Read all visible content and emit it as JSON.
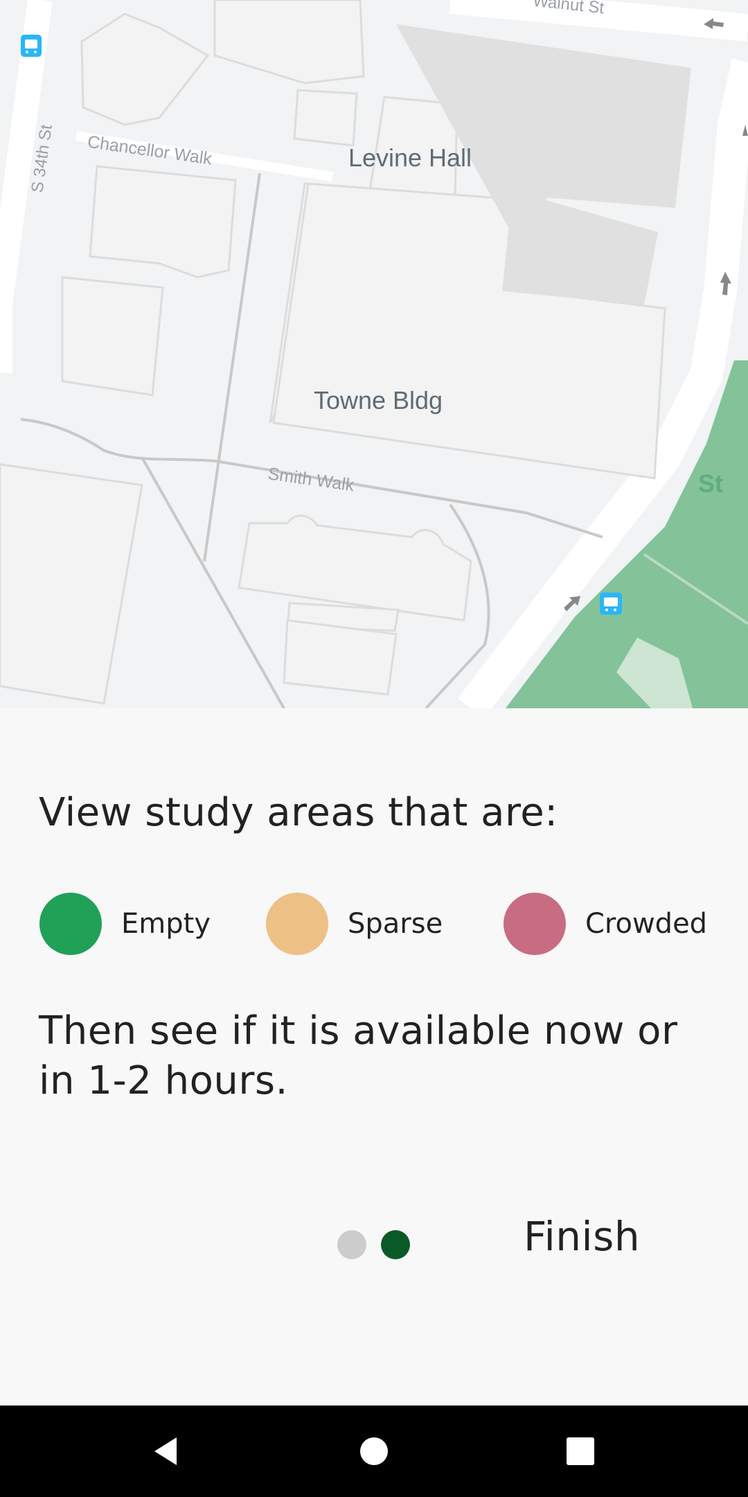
{
  "map": {
    "labels": {
      "levine_hall": "Levine Hall",
      "towne_bldg": "Towne Bldg",
      "chancellor_walk": "Chancellor Walk",
      "smith_walk": "Smith Walk",
      "s34th_st": "S 34th St",
      "walnut_st": "Walnut St",
      "park_label": "St"
    },
    "colors": {
      "background": "#f1f3f4",
      "building": "#f3f3f3",
      "building_edge": "#dcdcdc",
      "dark_building": "#e0e0e0",
      "road": "#ffffff",
      "path": "#c8c8c8",
      "park": "#84c29a",
      "park_light": "#cde5d3",
      "transit_icon": "#29b6f6"
    },
    "icons": [
      "bus-stop-icon",
      "direction-arrow-icon"
    ]
  },
  "panel": {
    "heading": "View study areas that are:",
    "legend": [
      {
        "label": "Empty",
        "color": "#21a058"
      },
      {
        "label": "Sparse",
        "color": "#edc086"
      },
      {
        "label": "Crowded",
        "color": "#c86c82"
      }
    ],
    "description": "Then see if it is available now or in 1-2 hours.",
    "pager": {
      "total": 2,
      "current": 2,
      "inactive_color": "#cccccc",
      "active_color": "#0b5a26"
    },
    "finish_label": "Finish"
  },
  "navbar": {
    "background": "#000000",
    "icons": [
      "back-icon",
      "home-icon",
      "recents-icon"
    ]
  }
}
